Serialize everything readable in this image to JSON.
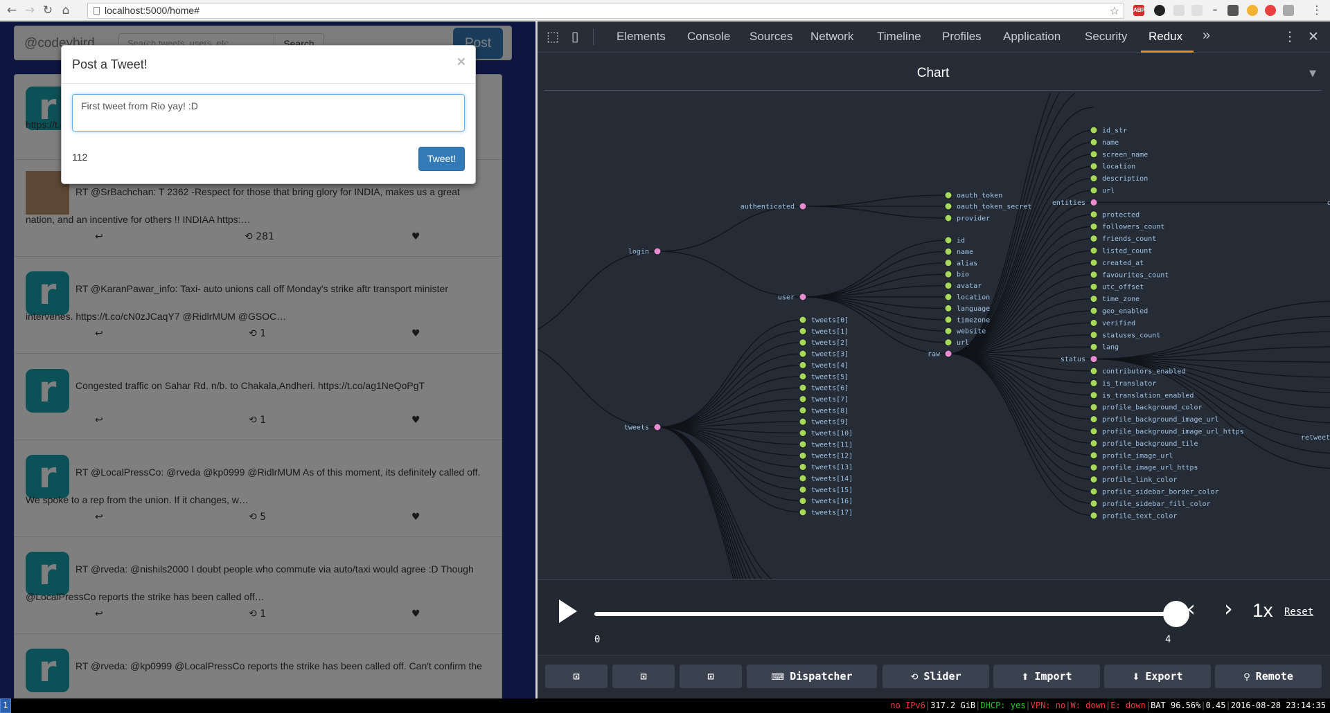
{
  "browser": {
    "url": "localhost:5000/home#"
  },
  "app": {
    "brand": "@codeybird",
    "search_placeholder": "Search tweets, users, etc",
    "search_button": "Search",
    "post_button": "Post",
    "tweets": [
      {
        "text": "https://t.co/...",
        "retweets": ""
      },
      {
        "text_line1": "RT @SrBachchan: T 2362 -Respect for those that bring glory for INDIA, makes us a great",
        "text_line2": "nation, and an incentive for others !! INDIAA https:…",
        "retweets": "281"
      },
      {
        "text_line1": "RT @KaranPawar_info: Taxi- auto unions call off Monday's strike aftr transport minister",
        "text_line2": "intervenes. https://t.co/cN0zJCaqY7 @RidlrMUM @GSOC…",
        "retweets": "1"
      },
      {
        "text_line1": "Congested traffic on Sahar Rd. n/b. to Chakala,Andheri. https://t.co/ag1NeQoPgT",
        "text_line2": "",
        "retweets": "1"
      },
      {
        "text_line1": "RT @LocalPressCo: @rveda @kp0999 @RidlrMUM As of this moment, its definitely called off.",
        "text_line2": "We spoke to a rep from the union. If it changes, w…",
        "retweets": "5"
      },
      {
        "text_line1": "RT @rveda: @nishils2000 I doubt people who commute via auto/taxi would agree :D Though",
        "text_line2": "@LocalPressCo reports the strike has been called off…",
        "retweets": "1"
      },
      {
        "text_line1": "RT @rveda: @kp0999 @LocalPressCo reports the strike has been called off. Can't confirm the",
        "text_line2": "",
        "retweets": ""
      }
    ],
    "modal": {
      "title": "Post a Tweet!",
      "close": "×",
      "tweet_value": "First tweet from Rio yay! :D",
      "char_count": "112",
      "submit": "Tweet!"
    }
  },
  "devtools": {
    "tabs": [
      "Elements",
      "Console",
      "Sources",
      "Network",
      "Timeline",
      "Profiles",
      "Application",
      "Security",
      "Redux"
    ],
    "active_tab": "Redux",
    "more": "»",
    "panel_title": "Chart",
    "tree": {
      "level1": [
        "login",
        "tweets"
      ],
      "login_children": [
        "authenticated",
        "user"
      ],
      "authenticated_children": [
        "oauth_token",
        "oauth_token_secret",
        "provider"
      ],
      "user_children": [
        "id",
        "name",
        "alias",
        "bio",
        "avatar",
        "location",
        "language",
        "timezone",
        "website",
        "url"
      ],
      "tweets_children": [
        "tweets[0]",
        "tweets[1]",
        "tweets[2]",
        "tweets[3]",
        "tweets[4]",
        "tweets[5]",
        "tweets[6]",
        "tweets[7]",
        "tweets[8]",
        "tweets[9]",
        "tweets[10]",
        "tweets[11]",
        "tweets[12]",
        "tweets[13]",
        "tweets[14]",
        "tweets[15]",
        "tweets[16]",
        "tweets[17]"
      ],
      "raw_node": "raw",
      "raw_children": [
        "id_str",
        "name",
        "screen_name",
        "location",
        "description",
        "url",
        "entities",
        "protected",
        "followers_count",
        "friends_count",
        "listed_count",
        "created_at",
        "favourites_count",
        "utc_offset",
        "time_zone",
        "geo_enabled",
        "verified",
        "statuses_count",
        "lang",
        "status",
        "contributors_enabled",
        "is_translator",
        "is_translation_enabled",
        "profile_background_color",
        "profile_background_image_url",
        "profile_background_image_url_https",
        "profile_background_tile",
        "profile_image_url",
        "profile_image_url_https",
        "profile_link_color",
        "profile_sidebar_border_color",
        "profile_sidebar_fill_color",
        "profile_text_color"
      ],
      "entities_child": "des",
      "status_child": "retweete"
    },
    "slider": {
      "min_label": "0",
      "max_label": "4",
      "value_fraction": 1.0,
      "speed": "1x",
      "reset": "Reset"
    },
    "buttons": [
      {
        "label": "",
        "icon": "layout-left-icon"
      },
      {
        "label": "",
        "icon": "layout-right-icon"
      },
      {
        "label": "",
        "icon": "layout-bottom-icon"
      },
      {
        "label": "Dispatcher",
        "icon": "keyboard-icon"
      },
      {
        "label": "Slider",
        "icon": "history-icon"
      },
      {
        "label": "Import",
        "icon": "upload-icon"
      },
      {
        "label": "Export",
        "icon": "download-icon"
      },
      {
        "label": "Remote",
        "icon": "antenna-icon"
      }
    ]
  },
  "statusbar": {
    "workspace": "1",
    "ipv6": "no IPv6",
    "disk": "317.2 GiB",
    "dhcp": "DHCP: yes",
    "vpn": "VPN: no",
    "wifi": "W: down",
    "eth": "E: down",
    "battery": "BAT 96.56%",
    "load": "0.45",
    "datetime": "2016-08-28 23:14:35"
  },
  "colors": {
    "accent_blue": "#337ab7",
    "redux_tab_underline": "#e38c2c",
    "tree_inner_node": "#e88bd0",
    "tree_leaf_node": "#a6d85a"
  }
}
